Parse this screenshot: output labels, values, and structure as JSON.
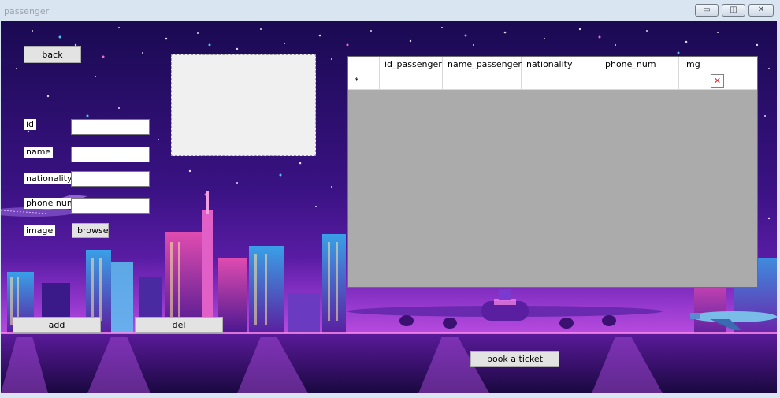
{
  "window": {
    "title": "passenger",
    "minimize_glyph": "▭",
    "maximize_glyph": "◫",
    "close_glyph": "✕"
  },
  "form": {
    "back_label": "back",
    "id_label": "id",
    "name_label": "name",
    "nationality_label": "nationality",
    "phone_label": "phone num",
    "image_label": "image",
    "browse_label": "browse",
    "id_value": "",
    "name_value": "",
    "nationality_value": "",
    "phone_value": ""
  },
  "actions": {
    "add_label": "add",
    "del_label": "del",
    "book_label": "book a ticket"
  },
  "grid": {
    "columns": [
      "id_passenger",
      "name_passenger",
      "nationality",
      "phone_num",
      "img"
    ],
    "new_row_marker": "*",
    "img_placeholder": "✕"
  },
  "colors": {
    "sky_top": "#1a0a52",
    "sky_mid": "#4d1a9c",
    "horizon": "#8a2fd0",
    "ground": "#2a0a55"
  }
}
